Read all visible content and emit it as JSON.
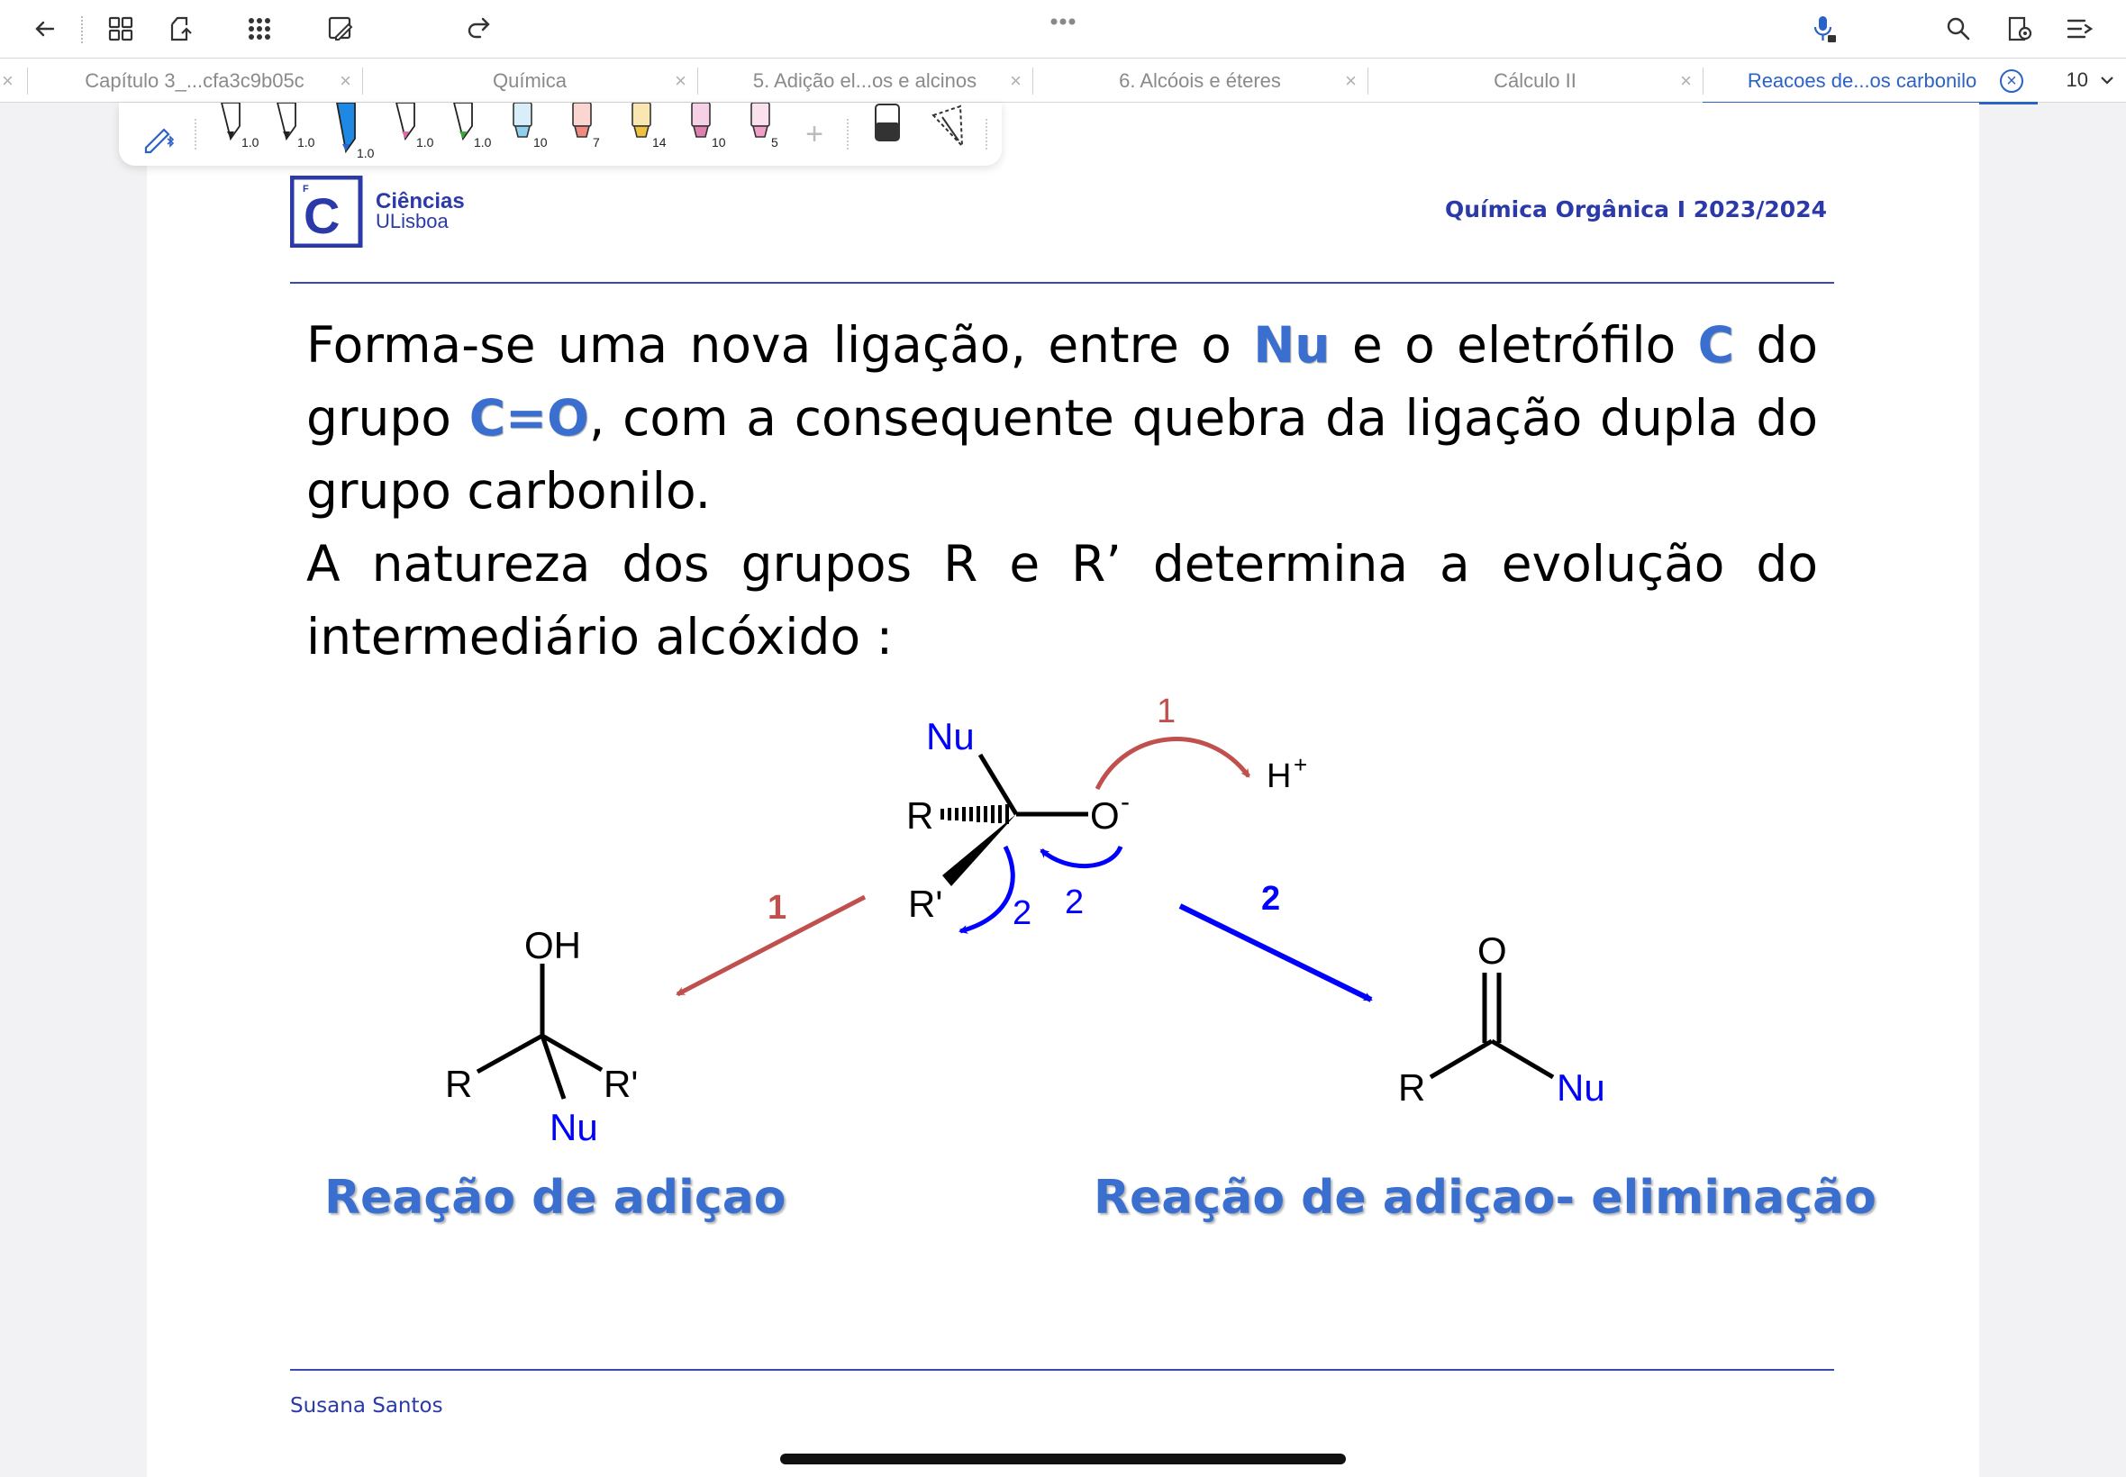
{
  "tabs": [
    {
      "label": "Capítulo 3_...cfa3c9b05c"
    },
    {
      "label": "Química"
    },
    {
      "label": "5. Adição el...os e alcinos"
    },
    {
      "label": "6. Alcóois e éteres"
    },
    {
      "label": "Cálculo II"
    },
    {
      "label": "Reacoes de...os carbonilo"
    }
  ],
  "page_count": "10",
  "pen_sizes": [
    "1.0",
    "1.0",
    "1.0",
    "1.0",
    "1.0",
    "10",
    "7",
    "14",
    "10",
    "5"
  ],
  "slide": {
    "logo_line1": "Ciências",
    "logo_line2": "ULisboa",
    "course": "Química Orgânica I 2023/2024",
    "paragraph": {
      "l1a": "Forma-se uma nova ligação,  entre o ",
      "nu": "Nu",
      "l1b": " e o eletrófilo ",
      "c": "C",
      "l1c": " do",
      "l2a": "grupo ",
      "co": "C=O",
      "l2b": ", com a consequente quebra da ligação dupla do",
      "l3": "grupo carbonilo.",
      "l4": "A natureza dos grupos R e R’ determina a evolução do",
      "l5": "intermediário alcóxido :"
    },
    "scheme": {
      "nu_top": "Nu",
      "r": "R",
      "r_prime": "R'",
      "o_minus": "O",
      "minus": "-",
      "h_plus": "H",
      "plus": "+",
      "step1": "1",
      "step2": "2",
      "left_oh": "OH",
      "left_r": "R",
      "left_rp": "R'",
      "left_nu": "Nu",
      "right_o": "O",
      "right_r": "R",
      "right_nu": "Nu"
    },
    "caption_left": "Reação de adiçao",
    "caption_right": "Reação de adiçao- eliminação",
    "footer": "Susana Santos"
  },
  "colors": {
    "accent": "#2b62c8",
    "red_arrow": "#c0504d",
    "blue_arrow": "#0000ff",
    "caption": "#3a6fd0"
  }
}
